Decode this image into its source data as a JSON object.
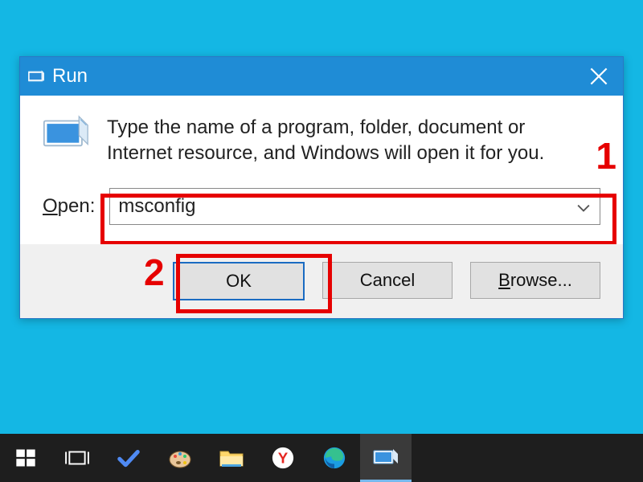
{
  "window": {
    "title": "Run",
    "instructions": "Type the name of a program, folder, document or Internet resource, and Windows will open it for you.",
    "open_label_pre": "O",
    "open_label_post": "pen:",
    "open_value": "msconfig",
    "buttons": {
      "ok": "OK",
      "cancel": "Cancel",
      "browse_pre": "B",
      "browse_post": "rowse..."
    }
  },
  "annotations": {
    "one": "1",
    "two": "2"
  },
  "taskbar": {
    "items": [
      {
        "name": "start"
      },
      {
        "name": "task-view"
      },
      {
        "name": "todo"
      },
      {
        "name": "paint"
      },
      {
        "name": "explorer"
      },
      {
        "name": "yandex"
      },
      {
        "name": "edge"
      },
      {
        "name": "run",
        "active": true
      }
    ]
  }
}
